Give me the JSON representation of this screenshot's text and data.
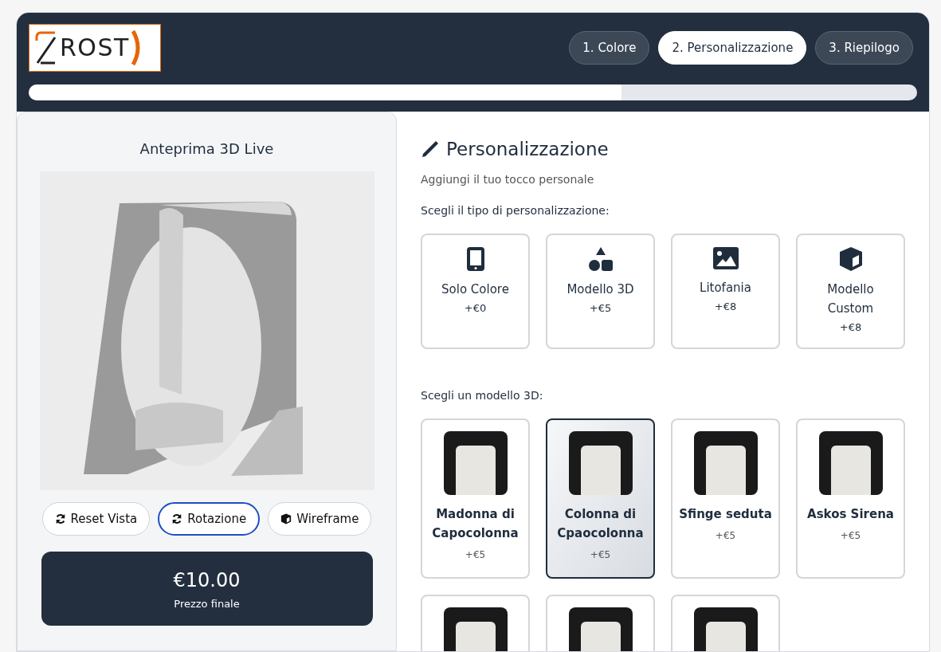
{
  "logo": {
    "text": "ROST"
  },
  "steps": [
    {
      "label": "1. Colore",
      "selected": false
    },
    {
      "label": "2. Personalizzazione",
      "selected": true
    },
    {
      "label": "3. Riepilogo",
      "selected": false
    }
  ],
  "progress": {
    "level": 0.667
  },
  "preview": {
    "title": "Anteprima 3D Live",
    "buttons": [
      {
        "label": "Reset Vista",
        "kind": "sync",
        "active": false
      },
      {
        "label": "Rotazione",
        "kind": "sync",
        "active": true
      },
      {
        "label": "Wireframe",
        "kind": "cube",
        "active": false
      }
    ],
    "price": "€10.00",
    "price_label": "Prezzo finale"
  },
  "section": {
    "title": "Personalizzazione",
    "subtitle": "Aggiungi il tuo tocco personale",
    "type_prompt": "Scegli il tipo di personalizzazione:",
    "types": [
      {
        "kind": "phone",
        "name": "Solo Colore",
        "price": "+€0",
        "selected": false
      },
      {
        "kind": "shapes",
        "name": "Modello 3D",
        "price": "+€5",
        "selected": false
      },
      {
        "kind": "image",
        "name": "Litofania",
        "price": "+€8",
        "selected": false
      },
      {
        "kind": "cube",
        "name": "Modello Custom",
        "price": "+€8",
        "selected": false
      }
    ],
    "model_prompt": "Scegli un modello 3D:",
    "models": [
      {
        "name": "Madonna di Capocolonna",
        "price": "+€5",
        "selected": false
      },
      {
        "name": "Colonna di Cpaocolonna",
        "price": "+€5",
        "selected": true
      },
      {
        "name": "Sfinge seduta",
        "price": "+€5",
        "selected": false
      },
      {
        "name": "Askos Sirena",
        "price": "+€5",
        "selected": false
      },
      {
        "selected": false
      },
      {
        "selected": false
      },
      {
        "selected": false
      }
    ]
  }
}
